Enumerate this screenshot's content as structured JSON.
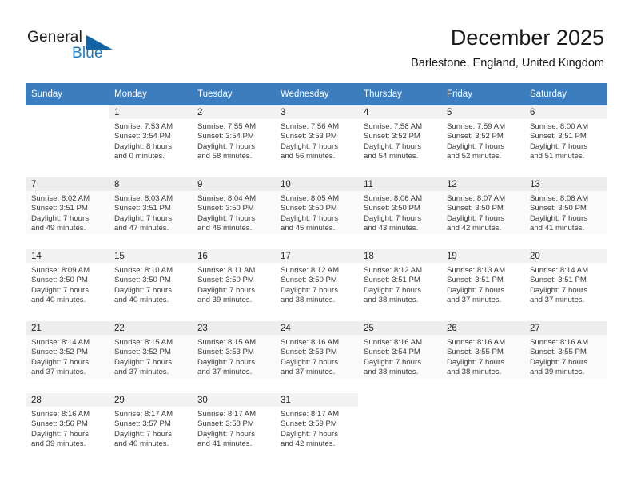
{
  "brand": {
    "name_top": "General",
    "name_bottom": "Blue",
    "triangle_color": "#1464a5",
    "blue_color": "#1e7bc4"
  },
  "header": {
    "title": "December 2025",
    "subtitle": "Barlestone, England, United Kingdom"
  },
  "theme": {
    "header_row_bg": "#3b7dbf",
    "header_row_text": "#ffffff",
    "daynum_band_bg": "#f2f2f2",
    "shaded_row_bg": "#fafafa"
  },
  "weekday_headers": [
    "Sunday",
    "Monday",
    "Tuesday",
    "Wednesday",
    "Thursday",
    "Friday",
    "Saturday"
  ],
  "weeks": [
    {
      "shaded": false,
      "days": [
        {
          "num": "",
          "sunrise": "",
          "sunset": "",
          "daylight1": "",
          "daylight2": ""
        },
        {
          "num": "1",
          "sunrise": "Sunrise: 7:53 AM",
          "sunset": "Sunset: 3:54 PM",
          "daylight1": "Daylight: 8 hours",
          "daylight2": "and 0 minutes."
        },
        {
          "num": "2",
          "sunrise": "Sunrise: 7:55 AM",
          "sunset": "Sunset: 3:54 PM",
          "daylight1": "Daylight: 7 hours",
          "daylight2": "and 58 minutes."
        },
        {
          "num": "3",
          "sunrise": "Sunrise: 7:56 AM",
          "sunset": "Sunset: 3:53 PM",
          "daylight1": "Daylight: 7 hours",
          "daylight2": "and 56 minutes."
        },
        {
          "num": "4",
          "sunrise": "Sunrise: 7:58 AM",
          "sunset": "Sunset: 3:52 PM",
          "daylight1": "Daylight: 7 hours",
          "daylight2": "and 54 minutes."
        },
        {
          "num": "5",
          "sunrise": "Sunrise: 7:59 AM",
          "sunset": "Sunset: 3:52 PM",
          "daylight1": "Daylight: 7 hours",
          "daylight2": "and 52 minutes."
        },
        {
          "num": "6",
          "sunrise": "Sunrise: 8:00 AM",
          "sunset": "Sunset: 3:51 PM",
          "daylight1": "Daylight: 7 hours",
          "daylight2": "and 51 minutes."
        }
      ]
    },
    {
      "shaded": true,
      "days": [
        {
          "num": "7",
          "sunrise": "Sunrise: 8:02 AM",
          "sunset": "Sunset: 3:51 PM",
          "daylight1": "Daylight: 7 hours",
          "daylight2": "and 49 minutes."
        },
        {
          "num": "8",
          "sunrise": "Sunrise: 8:03 AM",
          "sunset": "Sunset: 3:51 PM",
          "daylight1": "Daylight: 7 hours",
          "daylight2": "and 47 minutes."
        },
        {
          "num": "9",
          "sunrise": "Sunrise: 8:04 AM",
          "sunset": "Sunset: 3:50 PM",
          "daylight1": "Daylight: 7 hours",
          "daylight2": "and 46 minutes."
        },
        {
          "num": "10",
          "sunrise": "Sunrise: 8:05 AM",
          "sunset": "Sunset: 3:50 PM",
          "daylight1": "Daylight: 7 hours",
          "daylight2": "and 45 minutes."
        },
        {
          "num": "11",
          "sunrise": "Sunrise: 8:06 AM",
          "sunset": "Sunset: 3:50 PM",
          "daylight1": "Daylight: 7 hours",
          "daylight2": "and 43 minutes."
        },
        {
          "num": "12",
          "sunrise": "Sunrise: 8:07 AM",
          "sunset": "Sunset: 3:50 PM",
          "daylight1": "Daylight: 7 hours",
          "daylight2": "and 42 minutes."
        },
        {
          "num": "13",
          "sunrise": "Sunrise: 8:08 AM",
          "sunset": "Sunset: 3:50 PM",
          "daylight1": "Daylight: 7 hours",
          "daylight2": "and 41 minutes."
        }
      ]
    },
    {
      "shaded": false,
      "days": [
        {
          "num": "14",
          "sunrise": "Sunrise: 8:09 AM",
          "sunset": "Sunset: 3:50 PM",
          "daylight1": "Daylight: 7 hours",
          "daylight2": "and 40 minutes."
        },
        {
          "num": "15",
          "sunrise": "Sunrise: 8:10 AM",
          "sunset": "Sunset: 3:50 PM",
          "daylight1": "Daylight: 7 hours",
          "daylight2": "and 40 minutes."
        },
        {
          "num": "16",
          "sunrise": "Sunrise: 8:11 AM",
          "sunset": "Sunset: 3:50 PM",
          "daylight1": "Daylight: 7 hours",
          "daylight2": "and 39 minutes."
        },
        {
          "num": "17",
          "sunrise": "Sunrise: 8:12 AM",
          "sunset": "Sunset: 3:50 PM",
          "daylight1": "Daylight: 7 hours",
          "daylight2": "and 38 minutes."
        },
        {
          "num": "18",
          "sunrise": "Sunrise: 8:12 AM",
          "sunset": "Sunset: 3:51 PM",
          "daylight1": "Daylight: 7 hours",
          "daylight2": "and 38 minutes."
        },
        {
          "num": "19",
          "sunrise": "Sunrise: 8:13 AM",
          "sunset": "Sunset: 3:51 PM",
          "daylight1": "Daylight: 7 hours",
          "daylight2": "and 37 minutes."
        },
        {
          "num": "20",
          "sunrise": "Sunrise: 8:14 AM",
          "sunset": "Sunset: 3:51 PM",
          "daylight1": "Daylight: 7 hours",
          "daylight2": "and 37 minutes."
        }
      ]
    },
    {
      "shaded": true,
      "days": [
        {
          "num": "21",
          "sunrise": "Sunrise: 8:14 AM",
          "sunset": "Sunset: 3:52 PM",
          "daylight1": "Daylight: 7 hours",
          "daylight2": "and 37 minutes."
        },
        {
          "num": "22",
          "sunrise": "Sunrise: 8:15 AM",
          "sunset": "Sunset: 3:52 PM",
          "daylight1": "Daylight: 7 hours",
          "daylight2": "and 37 minutes."
        },
        {
          "num": "23",
          "sunrise": "Sunrise: 8:15 AM",
          "sunset": "Sunset: 3:53 PM",
          "daylight1": "Daylight: 7 hours",
          "daylight2": "and 37 minutes."
        },
        {
          "num": "24",
          "sunrise": "Sunrise: 8:16 AM",
          "sunset": "Sunset: 3:53 PM",
          "daylight1": "Daylight: 7 hours",
          "daylight2": "and 37 minutes."
        },
        {
          "num": "25",
          "sunrise": "Sunrise: 8:16 AM",
          "sunset": "Sunset: 3:54 PM",
          "daylight1": "Daylight: 7 hours",
          "daylight2": "and 38 minutes."
        },
        {
          "num": "26",
          "sunrise": "Sunrise: 8:16 AM",
          "sunset": "Sunset: 3:55 PM",
          "daylight1": "Daylight: 7 hours",
          "daylight2": "and 38 minutes."
        },
        {
          "num": "27",
          "sunrise": "Sunrise: 8:16 AM",
          "sunset": "Sunset: 3:55 PM",
          "daylight1": "Daylight: 7 hours",
          "daylight2": "and 39 minutes."
        }
      ]
    },
    {
      "shaded": false,
      "days": [
        {
          "num": "28",
          "sunrise": "Sunrise: 8:16 AM",
          "sunset": "Sunset: 3:56 PM",
          "daylight1": "Daylight: 7 hours",
          "daylight2": "and 39 minutes."
        },
        {
          "num": "29",
          "sunrise": "Sunrise: 8:17 AM",
          "sunset": "Sunset: 3:57 PM",
          "daylight1": "Daylight: 7 hours",
          "daylight2": "and 40 minutes."
        },
        {
          "num": "30",
          "sunrise": "Sunrise: 8:17 AM",
          "sunset": "Sunset: 3:58 PM",
          "daylight1": "Daylight: 7 hours",
          "daylight2": "and 41 minutes."
        },
        {
          "num": "31",
          "sunrise": "Sunrise: 8:17 AM",
          "sunset": "Sunset: 3:59 PM",
          "daylight1": "Daylight: 7 hours",
          "daylight2": "and 42 minutes."
        },
        {
          "num": "",
          "sunrise": "",
          "sunset": "",
          "daylight1": "",
          "daylight2": ""
        },
        {
          "num": "",
          "sunrise": "",
          "sunset": "",
          "daylight1": "",
          "daylight2": ""
        },
        {
          "num": "",
          "sunrise": "",
          "sunset": "",
          "daylight1": "",
          "daylight2": ""
        }
      ]
    }
  ]
}
